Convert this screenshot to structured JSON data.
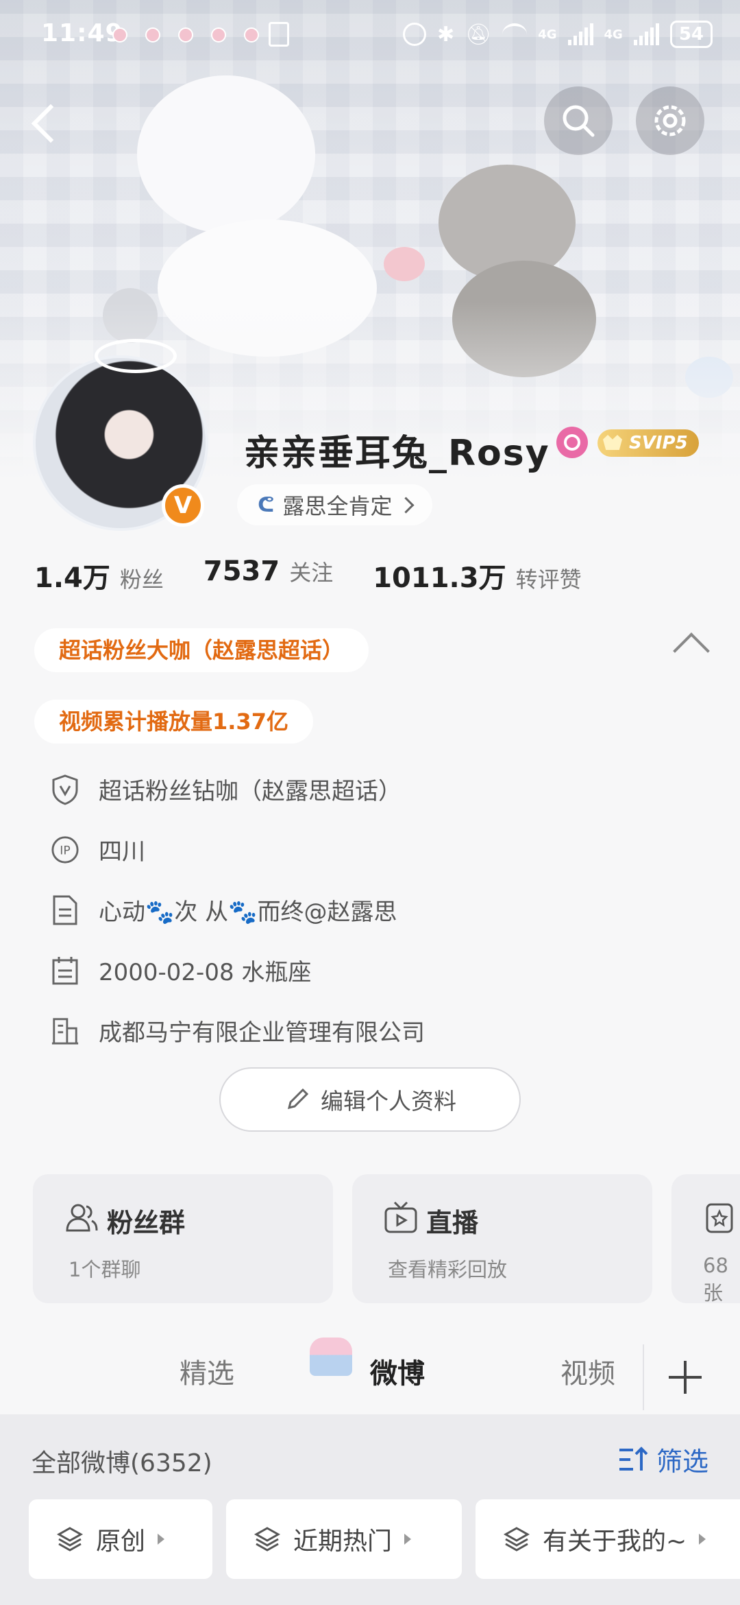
{
  "status_bar": {
    "time": "11:49",
    "net1": "4G",
    "net2": "4G",
    "battery": "54"
  },
  "profile": {
    "username": "亲亲垂耳兔_Rosy",
    "membership": "SVIP5",
    "honor_text": "露思全肯定",
    "verified_mark": "V"
  },
  "stats": [
    {
      "value": "1.4万",
      "label": "粉丝"
    },
    {
      "value": "7537",
      "label": "关注"
    },
    {
      "value": "1011.3万",
      "label": "转评赞"
    }
  ],
  "honors": [
    "超话粉丝大咖（赵露思超话）",
    "视频累计播放量1.37亿"
  ],
  "info_rows": [
    {
      "icon": "shield-v-icon",
      "text": "超话粉丝钻咖（赵露思超话）"
    },
    {
      "icon": "ip-icon",
      "text": "四川"
    },
    {
      "icon": "document-icon",
      "text": "心动🐾次 从🐾而终@赵露思"
    },
    {
      "icon": "calendar-icon",
      "text": "2000-02-08 水瓶座"
    },
    {
      "icon": "company-icon",
      "text": "成都马宁有限企业管理有限公司"
    }
  ],
  "edit_button": "编辑个人资料",
  "cards": [
    {
      "icon": "fans-group-icon",
      "title": "粉丝群",
      "sub": "1个群聊"
    },
    {
      "icon": "tv-icon",
      "title": "直播",
      "sub": "查看精彩回放"
    },
    {
      "icon": "star-card-icon",
      "title": "",
      "sub": "68张"
    }
  ],
  "tabs": [
    "精选",
    "微博",
    "视频"
  ],
  "active_tab": "微博",
  "feed": {
    "count_label": "全部微博(6352)",
    "filter_label": "筛选",
    "filters": [
      "原创",
      "近期热门",
      "有关于我的~"
    ]
  },
  "colors": {
    "accent_orange": "#e26a12",
    "link_blue": "#2c68c5",
    "verified_orange": "#f08a1c"
  }
}
